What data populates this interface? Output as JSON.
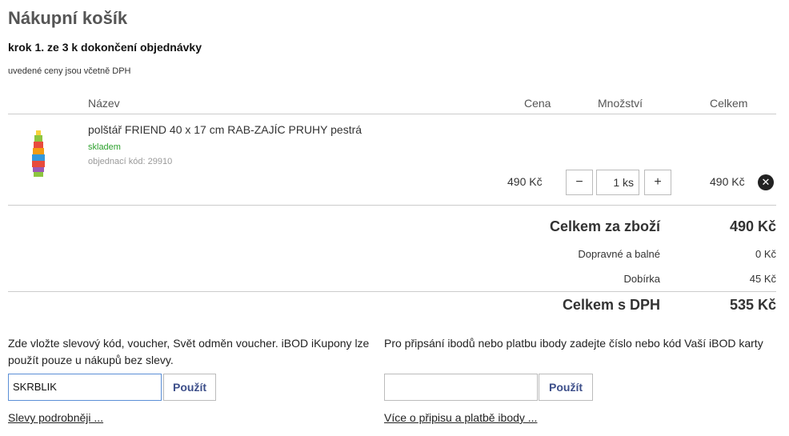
{
  "cart": {
    "title": "Nákupní košík",
    "step": "krok 1. ze 3 k dokončení objednávky",
    "vat_note": "uvedené ceny jsou včetně DPH"
  },
  "table": {
    "headers": {
      "name": "Název",
      "price": "Cena",
      "qty": "Množství",
      "total": "Celkem"
    }
  },
  "item": {
    "name": "polštář FRIEND 40 x 17 cm RAB-ZAJÍC PRUHY pestrá",
    "stock": "skladem",
    "code": "objednací kód: 29910",
    "price": "490 Kč",
    "qty_minus": "−",
    "qty_value": "1 ks",
    "qty_plus": "+",
    "total": "490 Kč",
    "remove_icon": "✕"
  },
  "summary": {
    "goods_label": "Celkem za zboží",
    "goods_value": "490 Kč",
    "shipping_label": "Dopravné a balné",
    "shipping_value": "0 Kč",
    "cod_label": "Dobírka",
    "cod_value": "45 Kč",
    "total_label": "Celkem s DPH",
    "total_value": "535 Kč"
  },
  "voucher": {
    "text": "Zde vložte slevový kód, voucher, Svět odměn voucher. iBOD iKupony lze použít pouze u nákupů bez slevy.",
    "value": "SKRBLIK",
    "button": "Použít",
    "link": "Slevy podrobněji ..."
  },
  "ibod": {
    "text": "Pro připsání ibodů nebo platbu ibody zadejte číslo nebo kód Vaší iBOD karty",
    "value": "",
    "button": "Použít",
    "link": "Více o připisu a platbě ibody ..."
  },
  "colors": {
    "stock": "#2ea12e",
    "button_text": "#3d4f8a",
    "focus_border": "#5b8fd6"
  }
}
